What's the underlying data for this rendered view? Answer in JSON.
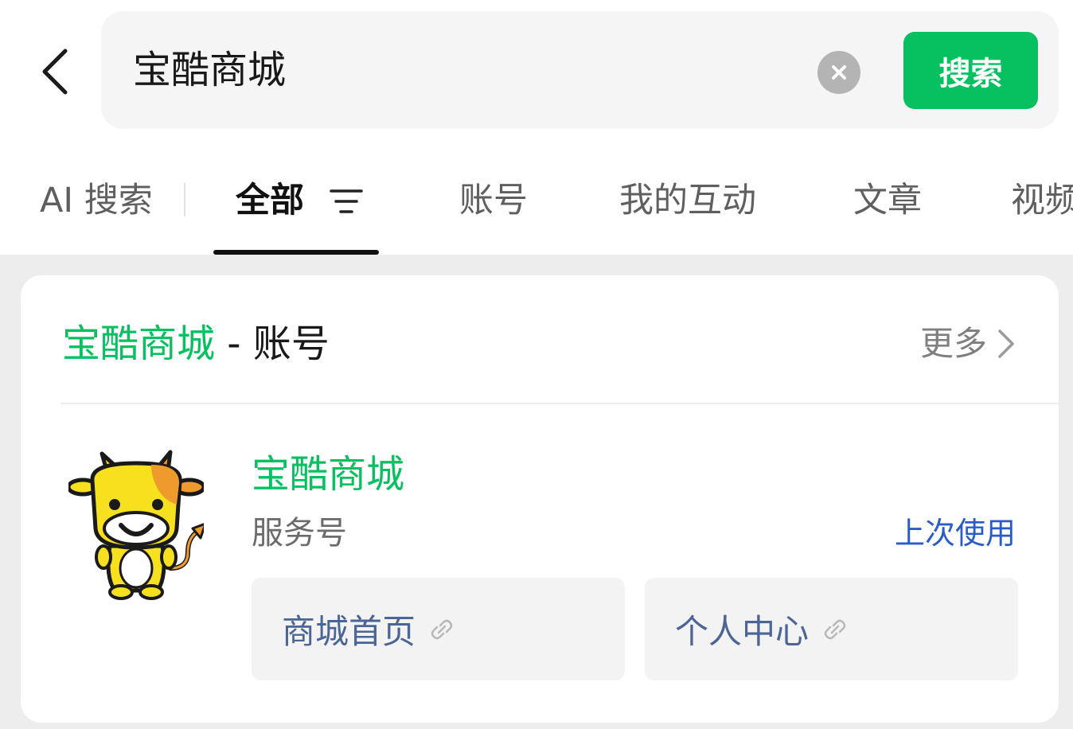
{
  "search": {
    "query": "宝酷商城",
    "button_label": "搜索"
  },
  "tabs": [
    {
      "label": "AI 搜索"
    },
    {
      "label": "全部"
    },
    {
      "label": "账号"
    },
    {
      "label": "我的互动"
    },
    {
      "label": "文章"
    },
    {
      "label": "视频"
    }
  ],
  "account_section": {
    "title_keyword": "宝酷商城",
    "title_suffix": " - 账号",
    "more_label": "更多",
    "account": {
      "name": "宝酷商城",
      "type": "服务号",
      "recent_tag": "上次使用",
      "quick_links": [
        {
          "label": "商城首页"
        },
        {
          "label": "个人中心"
        }
      ]
    }
  },
  "colors": {
    "brand_green": "#07c160",
    "link_blue": "#2a5cc9",
    "quick_link_text": "#4b6696",
    "avatar_yellow": "#f7e11f",
    "avatar_orange": "#ee9a2c"
  },
  "icons": [
    "chevron-left-icon",
    "clear-icon",
    "filter-icon",
    "chevron-right-icon",
    "link-icon"
  ]
}
